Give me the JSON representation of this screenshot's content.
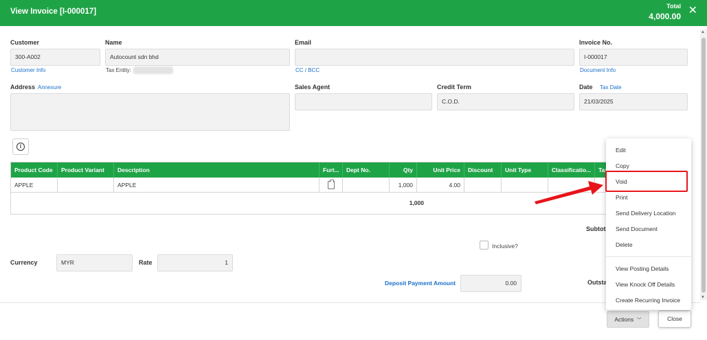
{
  "header": {
    "title": "View Invoice [I-000017]",
    "total_label": "Total",
    "total_value": "4,000.00",
    "close_icon": "close-icon"
  },
  "form": {
    "customer": {
      "label": "Customer",
      "value": "300-A002",
      "link": "Customer Info"
    },
    "name": {
      "label": "Name",
      "value": "Autocount sdn bhd",
      "tax_entity_label": "Tax Entity:"
    },
    "email": {
      "label": "Email",
      "value": "",
      "link": "CC / BCC"
    },
    "invoice_no": {
      "label": "Invoice No.",
      "value": "I-000017",
      "link": "Document Info"
    },
    "address": {
      "label": "Address",
      "link": "Annexure",
      "value": ""
    },
    "sales_agent": {
      "label": "Sales Agent",
      "value": ""
    },
    "credit_term": {
      "label": "Credit Term",
      "value": "C.O.D."
    },
    "date": {
      "label": "Date",
      "link": "Tax Date",
      "value": "21/03/2025"
    }
  },
  "grid": {
    "columns": [
      "Product Code",
      "Product Variant",
      "Description",
      "Furt...",
      "Dept No.",
      "Qty",
      "Unit Price",
      "Discount",
      "Unit Type",
      "Classificatio...",
      "Tax"
    ],
    "rows": [
      {
        "product_code": "APPLE",
        "product_variant": "",
        "description": "APPLE",
        "dept_no": "",
        "qty": "1,000",
        "unit_price": "4.00",
        "discount": "",
        "unit_type": "",
        "classification": ""
      }
    ],
    "qty_total": "1,000"
  },
  "summary": {
    "subtotal_label": "Subtotal",
    "inclusive_label": "Inclusive?",
    "currency_label": "Currency",
    "currency_value": "MYR",
    "rate_label": "Rate",
    "rate_value": "1",
    "deposit_label": "Deposit Payment Amount",
    "deposit_value": "0.00",
    "outstanding_label": "Outstanding"
  },
  "menu": {
    "items": [
      "Edit",
      "Copy",
      "Void",
      "Print",
      "Send Delivery Location",
      "Send Document",
      "Delete",
      "View Posting Details",
      "View Knock Off Details",
      "Create Recurring Invoice"
    ],
    "highlighted": "Void"
  },
  "footer": {
    "actions_label": "Actions",
    "close_label": "Close"
  },
  "colors": {
    "brand_green": "#1fa347",
    "link_blue": "#1a6fc9",
    "annotation_red": "#e8141b"
  }
}
